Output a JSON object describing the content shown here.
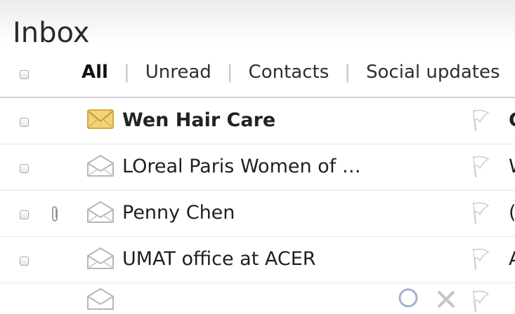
{
  "page": {
    "title": "Inbox"
  },
  "filters": [
    {
      "label": "All",
      "active": true
    },
    {
      "label": "Unread",
      "active": false
    },
    {
      "label": "Contacts",
      "active": false
    },
    {
      "label": "Social updates",
      "active": false
    }
  ],
  "filter_separator": "|",
  "messages": [
    {
      "sender": "Wen Hair Care",
      "subject_start": "C",
      "unread": true,
      "has_attachment": false,
      "icon": "envelope-closed-icon"
    },
    {
      "sender": "LOreal Paris Women of …",
      "subject_start": "W",
      "unread": false,
      "has_attachment": false,
      "icon": "envelope-open-icon"
    },
    {
      "sender": "Penny Chen",
      "subject_start": "(",
      "unread": false,
      "has_attachment": true,
      "icon": "envelope-open-icon"
    },
    {
      "sender": "UMAT office at ACER",
      "subject_start": "A",
      "unread": false,
      "has_attachment": false,
      "icon": "envelope-open-icon"
    }
  ],
  "colors": {
    "unread_envelope": "#e8c25a",
    "read_envelope": "#b8b8b8",
    "separator": "#c4c4c4",
    "divider": "#cfcfcf"
  }
}
